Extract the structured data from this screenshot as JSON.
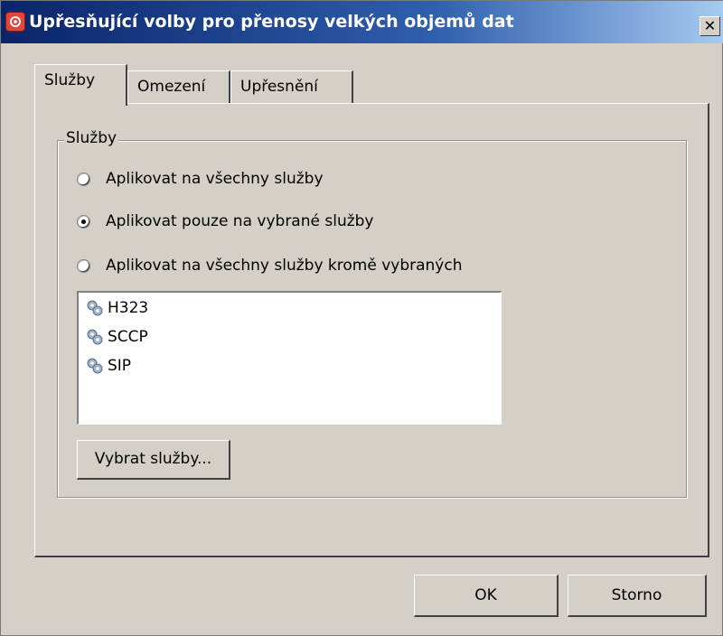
{
  "window": {
    "title": "Upřesňující volby pro přenosy velkých objemů dat",
    "close_label": "✕"
  },
  "tabs": [
    {
      "label": "Služby",
      "active": true
    },
    {
      "label": "Omezení",
      "active": false
    },
    {
      "label": "Upřesnění",
      "active": false
    }
  ],
  "services_group": {
    "title": "Služby",
    "options": [
      {
        "label": "Aplikovat na všechny služby",
        "selected": false
      },
      {
        "label": "Aplikovat pouze na vybrané služby",
        "selected": true
      },
      {
        "label": "Aplikovat na všechny služby kromě vybraných",
        "selected": false
      }
    ],
    "list_items": [
      "H323",
      "SCCP",
      "SIP"
    ],
    "item_icon": "gear-icon",
    "select_button_label": "Vybrat služby..."
  },
  "footer": {
    "ok_label": "OK",
    "cancel_label": "Storno"
  }
}
